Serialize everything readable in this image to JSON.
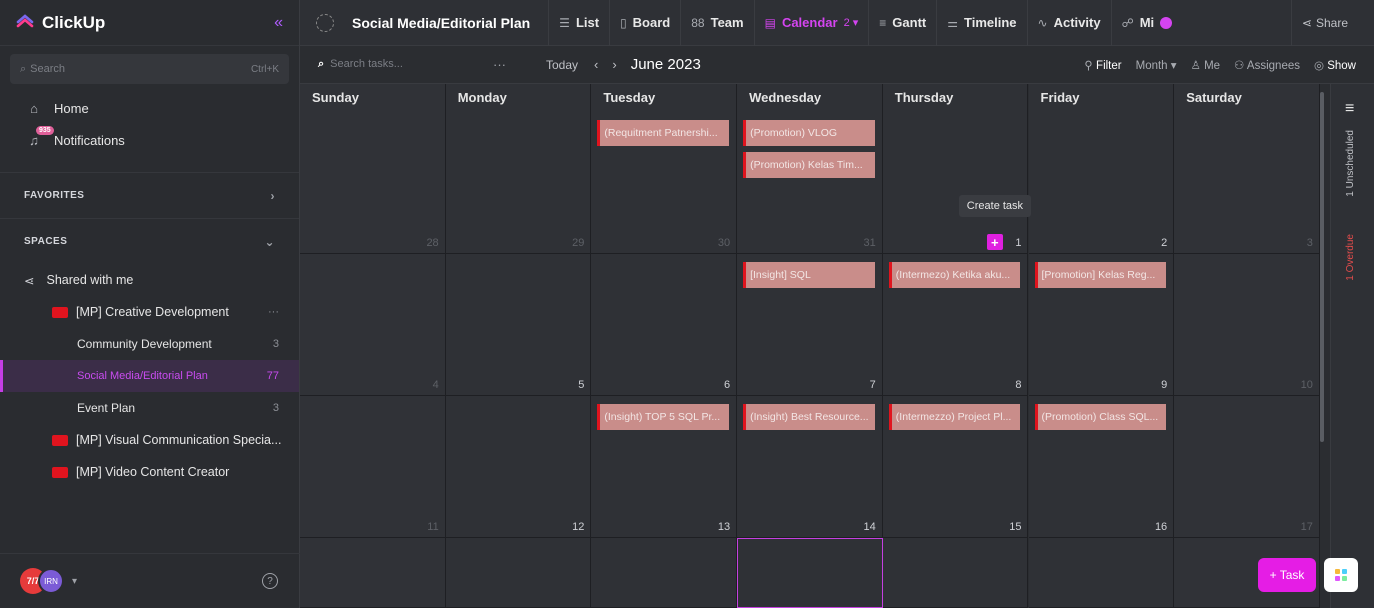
{
  "app": {
    "name": "ClickUp"
  },
  "sidebar": {
    "search_placeholder": "Search",
    "search_shortcut": "Ctrl+K",
    "nav": [
      {
        "label": "Home",
        "icon": "home-icon"
      },
      {
        "label": "Notifications",
        "icon": "bell-icon",
        "badge": "935"
      }
    ],
    "favorites_label": "FAVORITES",
    "spaces_label": "SPACES",
    "shared_label": "Shared with me",
    "folders": [
      {
        "label": "[MP] Creative Development",
        "more": "···"
      },
      {
        "label": "Community Development",
        "count": "3",
        "child": true
      },
      {
        "label": "Social Media/Editorial Plan",
        "count": "77",
        "child": true,
        "active": true
      },
      {
        "label": "Event Plan",
        "count": "3",
        "child": true
      },
      {
        "label": "[MP] Visual Communication Specia...",
        "folder": true
      },
      {
        "label": "[MP] Video Content Creator",
        "folder": true
      }
    ],
    "avatar_text": "7/7",
    "avatar2_text": "IRN"
  },
  "header": {
    "title": "Social Media/Editorial Plan",
    "tabs": [
      {
        "label": "List",
        "icon": "☰"
      },
      {
        "label": "Board",
        "icon": "▯"
      },
      {
        "label": "Team",
        "icon": "88"
      },
      {
        "label": "Calendar",
        "icon": "▤",
        "suffix": "2 ▾",
        "active": true
      },
      {
        "label": "Gantt",
        "icon": "≡"
      },
      {
        "label": "Timeline",
        "icon": "⚌"
      },
      {
        "label": "Activity",
        "icon": "∿"
      },
      {
        "label": "Mi",
        "icon": "☍"
      }
    ],
    "share": "Share"
  },
  "toolbar": {
    "search_placeholder": "Search tasks...",
    "today": "Today",
    "month": "June 2023",
    "filter": "Filter",
    "view": "Month",
    "me": "Me",
    "assignees": "Assignees",
    "show": "Show"
  },
  "calendar": {
    "day_names": [
      "Sunday",
      "Monday",
      "Tuesday",
      "Wednesday",
      "Thursday",
      "Friday",
      "Saturday"
    ],
    "weeks": [
      [
        "28",
        "29",
        "30",
        "31",
        "1",
        "2",
        "3"
      ],
      [
        "4",
        "5",
        "6",
        "7",
        "8",
        "9",
        "10"
      ],
      [
        "11",
        "12",
        "13",
        "14",
        "15",
        "16",
        "17"
      ],
      [
        "",
        "",
        "",
        "",
        "",
        "",
        ""
      ]
    ],
    "tasks": {
      "w0d2a": "(Requitment Patnershi...",
      "w0d3a": "(Promotion) VLOG",
      "w0d3b": "(Promotion) Kelas Tim...",
      "w1d3": "[Insight] SQL",
      "w1d4": "(Intermezo) Ketika aku...",
      "w1d5": "[Promotion] Kelas Reg...",
      "w2d2": "(Insight) TOP 5 SQL Pr...",
      "w2d3": "(Insight) Best Resource...",
      "w2d4": "(Intermezzo) Project Pl...",
      "w2d5": "(Promotion) Class SQL..."
    },
    "create_tip": "Create task"
  },
  "rail": {
    "unscheduled": "1 Unscheduled",
    "overdue": "1 Overdue"
  },
  "fab": {
    "task": "+ Task"
  }
}
